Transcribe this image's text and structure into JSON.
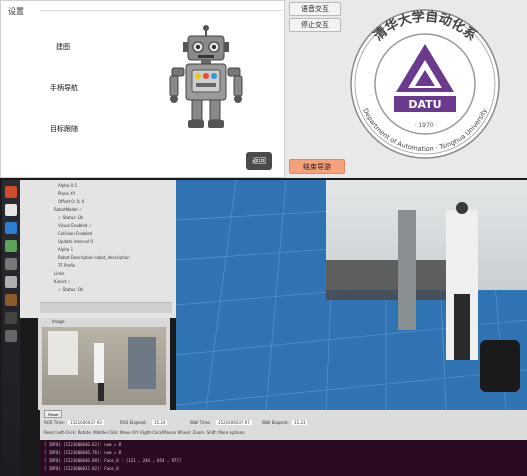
{
  "settings": {
    "title": "设置",
    "buttons": {
      "map": "建图",
      "handle_nav": "手柄导航",
      "target_follow": "目标跟随",
      "back": "返回"
    }
  },
  "side_buttons": {
    "voice_interaction": "语音交互",
    "stop_interaction": "停止交互",
    "end_guide": "结束导游"
  },
  "seal": {
    "center_text": "DATU",
    "university_text": "清华大学自动化系",
    "english_text": "Department of Automation · Tsinghua University",
    "year_text": "· 1970 ·"
  },
  "rviz": {
    "tree_rows": [
      "Alpha  0.5",
      "Plane  XY",
      "Offset  0; 0; 0",
      "RobotModel  ✓",
      "✓ Status: Ok",
      "Visual Enabled  ✓",
      "Collision Enabled",
      "Update Interval  0",
      "Alpha  1",
      "Robot Description  robot_description",
      "TF Prefix",
      "Links",
      "Kinect  ✓",
      "✓ Status: Ok"
    ],
    "camera_title": "Image",
    "time_bar": {
      "reset": "Reset",
      "ros_time_label": "ROS Time:",
      "ros_time": "1521606037.93",
      "ros_elapsed_label": "ROS Elapsed:",
      "ros_elapsed": "15.24",
      "wall_time_label": "Wall Time:",
      "wall_time": "1521606037.97",
      "wall_elapsed_label": "Wall Elapsed:",
      "wall_elapsed": "15.23",
      "hint": "Reset  Left-Click: Rotate.  Middle-Click: Move X/Y.  Right-Click/Mouse Wheel: Zoom.  Shift: More options."
    },
    "terminal_lines": [
      "[ INFO] [1521606036.62]: num = 0",
      "[ INFO] [1521606036.76]: num = 0",
      "[ INFO] [1521606036.89]: Face_0 : [121 , 244 , 854 , 977]",
      "[ INFO] [1521606037.02]: Face_0"
    ]
  },
  "colors": {
    "back_button": "#4a4a4a",
    "end_guide_button": "#f5a27a",
    "seal_purple": "#6b3a8e",
    "viewport_blue": "#2f73b3"
  },
  "icons": [
    "robot-icon",
    "datu-seal-logo"
  ]
}
